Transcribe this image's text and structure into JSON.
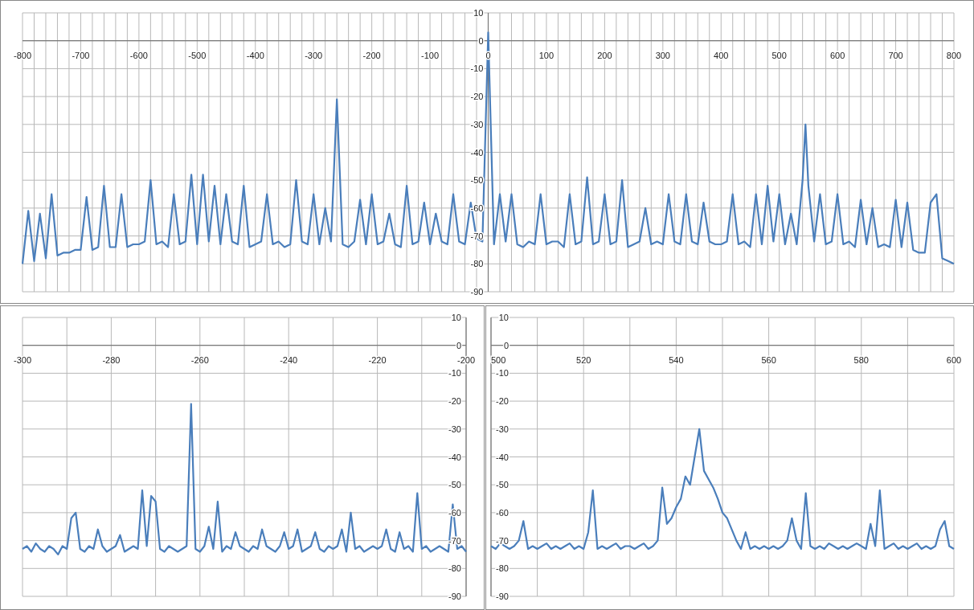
{
  "charts": [
    {
      "kind": "full",
      "chart_data": {
        "type": "line",
        "grid": true,
        "xlim": [
          -800,
          800
        ],
        "ylim": [
          -90,
          10
        ],
        "xticks": [
          -800,
          -700,
          -600,
          -500,
          -400,
          -300,
          -200,
          -100,
          0,
          100,
          200,
          300,
          400,
          500,
          600,
          700,
          800
        ],
        "yticks": [
          10,
          0,
          -10,
          -20,
          -30,
          -40,
          -50,
          -60,
          -70,
          -80,
          -90
        ],
        "x": [
          -800,
          -790,
          -780,
          -770,
          -760,
          -750,
          -740,
          -730,
          -720,
          -710,
          -700,
          -690,
          -680,
          -670,
          -660,
          -650,
          -640,
          -630,
          -620,
          -610,
          -600,
          -590,
          -580,
          -570,
          -560,
          -550,
          -540,
          -530,
          -520,
          -510,
          -500,
          -490,
          -480,
          -470,
          -460,
          -450,
          -440,
          -430,
          -420,
          -410,
          -400,
          -390,
          -380,
          -370,
          -360,
          -350,
          -340,
          -330,
          -320,
          -310,
          -300,
          -290,
          -280,
          -270,
          -260,
          -250,
          -240,
          -230,
          -220,
          -210,
          -200,
          -190,
          -180,
          -170,
          -160,
          -150,
          -140,
          -130,
          -120,
          -110,
          -100,
          -90,
          -80,
          -70,
          -60,
          -50,
          -40,
          -30,
          -20,
          -10,
          0,
          10,
          20,
          30,
          40,
          50,
          60,
          70,
          80,
          90,
          100,
          110,
          120,
          130,
          140,
          150,
          160,
          170,
          180,
          190,
          200,
          210,
          220,
          230,
          240,
          250,
          260,
          270,
          280,
          290,
          300,
          310,
          320,
          330,
          340,
          350,
          360,
          370,
          380,
          390,
          400,
          410,
          420,
          430,
          440,
          450,
          460,
          470,
          480,
          490,
          500,
          510,
          520,
          530,
          540,
          545,
          550,
          560,
          570,
          580,
          590,
          600,
          610,
          620,
          630,
          640,
          650,
          660,
          670,
          680,
          690,
          700,
          710,
          720,
          730,
          740,
          750,
          760,
          770,
          780,
          790,
          800
        ],
        "series": [
          {
            "color": "#4a7ebb",
            "values": [
              -80,
              -61,
              -79,
              -62,
              -78,
              -55,
              -77,
              -76,
              -76,
              -75,
              -75,
              -56,
              -75,
              -74,
              -52,
              -74,
              -74,
              -55,
              -74,
              -73,
              -73,
              -72,
              -50,
              -73,
              -72,
              -74,
              -55,
              -73,
              -72,
              -48,
              -73,
              -48,
              -72,
              -52,
              -73,
              -55,
              -72,
              -73,
              -52,
              -74,
              -73,
              -72,
              -55,
              -73,
              -72,
              -74,
              -73,
              -50,
              -72,
              -73,
              -55,
              -73,
              -60,
              -72,
              -21,
              -73,
              -74,
              -72,
              -57,
              -73,
              -55,
              -73,
              -72,
              -62,
              -73,
              -74,
              -52,
              -73,
              -72,
              -58,
              -73,
              -62,
              -72,
              -73,
              -55,
              -72,
              -73,
              -58,
              -71,
              -72,
              3,
              -73,
              -55,
              -72,
              -55,
              -73,
              -74,
              -72,
              -73,
              -55,
              -73,
              -72,
              -72,
              -74,
              -55,
              -73,
              -72,
              -49,
              -73,
              -72,
              -55,
              -73,
              -72,
              -50,
              -74,
              -73,
              -72,
              -60,
              -73,
              -72,
              -73,
              -55,
              -72,
              -73,
              -55,
              -72,
              -73,
              -58,
              -72,
              -73,
              -73,
              -72,
              -55,
              -73,
              -72,
              -74,
              -55,
              -73,
              -52,
              -72,
              -55,
              -73,
              -62,
              -73,
              -50,
              -30,
              -52,
              -72,
              -55,
              -73,
              -72,
              -55,
              -73,
              -72,
              -74,
              -57,
              -73,
              -60,
              -74,
              -73,
              -74,
              -57,
              -74,
              -58,
              -75,
              -76,
              -76,
              -58,
              -55,
              -78,
              -79,
              -80
            ]
          }
        ]
      }
    },
    {
      "kind": "zoom-left",
      "chart_data": {
        "type": "line",
        "grid": true,
        "xlim": [
          -300,
          -200
        ],
        "ylim": [
          -90,
          10
        ],
        "xticks": [
          -300,
          -280,
          -260,
          -240,
          -220,
          -200
        ],
        "yticks": [
          10,
          0,
          -10,
          -20,
          -30,
          -40,
          -50,
          -60,
          -70,
          -80,
          -90
        ],
        "x": [
          -300,
          -299,
          -298,
          -297,
          -296,
          -295,
          -294,
          -293,
          -292,
          -291,
          -290,
          -289,
          -288,
          -287,
          -286,
          -285,
          -284,
          -283,
          -282,
          -281,
          -280,
          -279,
          -278,
          -277,
          -276,
          -275,
          -274,
          -273,
          -272,
          -271,
          -270,
          -269,
          -268,
          -267,
          -266,
          -265,
          -264,
          -263,
          -262,
          -261,
          -260,
          -259,
          -258,
          -257,
          -256,
          -255,
          -254,
          -253,
          -252,
          -251,
          -250,
          -249,
          -248,
          -247,
          -246,
          -245,
          -244,
          -243,
          -242,
          -241,
          -240,
          -239,
          -238,
          -237,
          -236,
          -235,
          -234,
          -233,
          -232,
          -231,
          -230,
          -229,
          -228,
          -227,
          -226,
          -225,
          -224,
          -223,
          -222,
          -221,
          -220,
          -219,
          -218,
          -217,
          -216,
          -215,
          -214,
          -213,
          -212,
          -211,
          -210,
          -209,
          -208,
          -207,
          -206,
          -205,
          -204,
          -203,
          -202,
          -201,
          -200
        ],
        "series": [
          {
            "color": "#4a7ebb",
            "values": [
              -73,
              -72,
              -74,
              -71,
              -73,
              -74,
              -72,
              -73,
              -75,
              -72,
              -73,
              -62,
              -60,
              -73,
              -74,
              -72,
              -73,
              -66,
              -72,
              -74,
              -73,
              -72,
              -68,
              -74,
              -73,
              -72,
              -73,
              -52,
              -72,
              -54,
              -56,
              -73,
              -74,
              -72,
              -73,
              -74,
              -73,
              -72,
              -21,
              -73,
              -74,
              -72,
              -65,
              -73,
              -56,
              -74,
              -72,
              -73,
              -67,
              -72,
              -73,
              -74,
              -72,
              -73,
              -66,
              -72,
              -73,
              -74,
              -72,
              -67,
              -73,
              -72,
              -66,
              -74,
              -73,
              -72,
              -67,
              -73,
              -74,
              -72,
              -73,
              -72,
              -66,
              -74,
              -60,
              -73,
              -72,
              -74,
              -73,
              -72,
              -73,
              -72,
              -66,
              -73,
              -74,
              -67,
              -73,
              -72,
              -74,
              -53,
              -73,
              -72,
              -74,
              -73,
              -72,
              -73,
              -74,
              -57,
              -73,
              -72,
              -74
            ]
          }
        ]
      }
    },
    {
      "kind": "zoom-right",
      "chart_data": {
        "type": "line",
        "grid": true,
        "xlim": [
          500,
          600
        ],
        "ylim": [
          -90,
          10
        ],
        "xticks": [
          500,
          520,
          540,
          560,
          580,
          600
        ],
        "yticks": [
          10,
          0,
          -10,
          -20,
          -30,
          -40,
          -50,
          -60,
          -70,
          -80,
          -90
        ],
        "x": [
          500,
          501,
          502,
          503,
          504,
          505,
          506,
          507,
          508,
          509,
          510,
          511,
          512,
          513,
          514,
          515,
          516,
          517,
          518,
          519,
          520,
          521,
          522,
          523,
          524,
          525,
          526,
          527,
          528,
          529,
          530,
          531,
          532,
          533,
          534,
          535,
          536,
          537,
          538,
          539,
          540,
          541,
          542,
          543,
          544,
          545,
          546,
          547,
          548,
          549,
          550,
          551,
          552,
          553,
          554,
          555,
          556,
          557,
          558,
          559,
          560,
          561,
          562,
          563,
          564,
          565,
          566,
          567,
          568,
          569,
          570,
          571,
          572,
          573,
          574,
          575,
          576,
          577,
          578,
          579,
          580,
          581,
          582,
          583,
          584,
          585,
          586,
          587,
          588,
          589,
          590,
          591,
          592,
          593,
          594,
          595,
          596,
          597,
          598,
          599,
          600
        ],
        "series": [
          {
            "color": "#4a7ebb",
            "values": [
              -72,
              -73,
              -71,
              -72,
              -73,
              -72,
              -70,
              -63,
              -73,
              -72,
              -73,
              -72,
              -71,
              -73,
              -72,
              -73,
              -72,
              -71,
              -73,
              -72,
              -73,
              -67,
              -52,
              -73,
              -72,
              -73,
              -72,
              -71,
              -73,
              -72,
              -72,
              -73,
              -72,
              -71,
              -73,
              -72,
              -70,
              -51,
              -64,
              -62,
              -58,
              -55,
              -47,
              -50,
              -40,
              -30,
              -45,
              -48,
              -51,
              -55,
              -60,
              -62,
              -66,
              -70,
              -73,
              -67,
              -73,
              -72,
              -73,
              -72,
              -73,
              -72,
              -73,
              -72,
              -70,
              -62,
              -70,
              -73,
              -53,
              -72,
              -73,
              -72,
              -73,
              -71,
              -72,
              -73,
              -72,
              -73,
              -72,
              -71,
              -72,
              -73,
              -64,
              -72,
              -52,
              -73,
              -72,
              -71,
              -73,
              -72,
              -73,
              -72,
              -71,
              -73,
              -72,
              -73,
              -72,
              -66,
              -63,
              -72,
              -73
            ]
          }
        ]
      }
    }
  ]
}
